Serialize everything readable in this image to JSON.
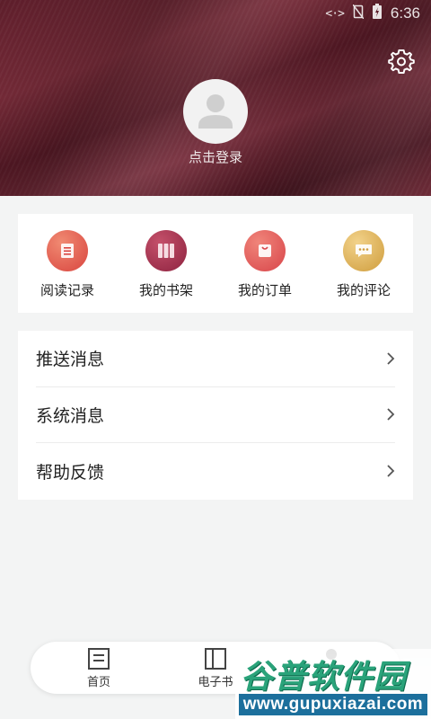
{
  "status_bar": {
    "time": "6:36"
  },
  "profile": {
    "login_prompt": "点击登录"
  },
  "shortcuts": [
    {
      "label": "阅读记录",
      "icon": "document-icon",
      "color": "#e0584e"
    },
    {
      "label": "我的书架",
      "icon": "books-icon",
      "color": "#a8304a"
    },
    {
      "label": "我的订单",
      "icon": "bag-icon",
      "color": "#df5a54"
    },
    {
      "label": "我的评论",
      "icon": "chat-bubble-icon",
      "color": "#d8a94c"
    }
  ],
  "menu": {
    "items": [
      {
        "label": "推送消息"
      },
      {
        "label": "系统消息"
      },
      {
        "label": "帮助反馈"
      }
    ]
  },
  "bottom_nav": {
    "items": [
      {
        "label": "首页",
        "icon": "home-icon"
      },
      {
        "label": "电子书",
        "icon": "ebook-icon"
      },
      {
        "label": "",
        "icon": "profile-icon"
      }
    ]
  },
  "watermark": {
    "title": "谷普软件园",
    "url": "www.gupuxiazai.com"
  }
}
